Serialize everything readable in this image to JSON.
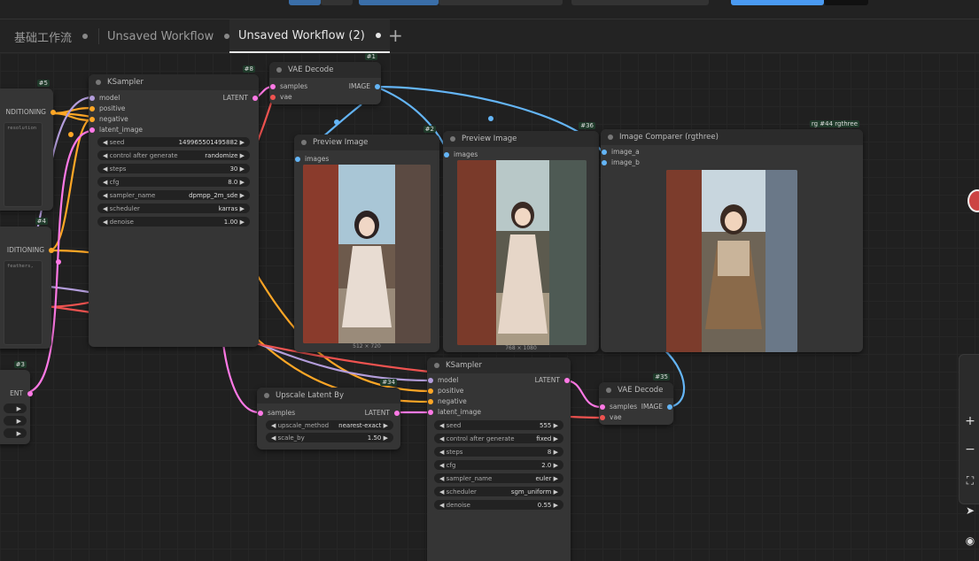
{
  "tabs": [
    {
      "label": "基础工作流",
      "active": false
    },
    {
      "label": "Unsaved Workflow",
      "active": false
    },
    {
      "label": "Unsaved Workflow (2)",
      "active": true
    }
  ],
  "tab_add_icon": "+",
  "colors": {
    "model": "#b39ddb",
    "clip_cond": "#ffa726",
    "latent": "#ff79e6",
    "image": "#64b5f6",
    "vae": "#ef5350"
  },
  "node5": {
    "id": "#5",
    "out_label": "NDITIONING",
    "text": "resolution"
  },
  "node4": {
    "id": "#4",
    "out_label": "IDITIONING",
    "text": "feathers,"
  },
  "node3": {
    "id": "#3",
    "out_label": "ENT"
  },
  "ksampler1": {
    "id": "#8",
    "title": "KSampler",
    "inputs": [
      "model",
      "positive",
      "negative",
      "latent_image"
    ],
    "output": "LATENT",
    "widgets": [
      {
        "name": "seed",
        "value": "149965501495882"
      },
      {
        "name": "control after generate",
        "value": "randomize"
      },
      {
        "name": "steps",
        "value": "30"
      },
      {
        "name": "cfg",
        "value": "8.0"
      },
      {
        "name": "sampler_name",
        "value": "dpmpp_2m_sde"
      },
      {
        "name": "scheduler",
        "value": "karras"
      },
      {
        "name": "denoise",
        "value": "1.00"
      }
    ]
  },
  "vaedecode1": {
    "id": "#1",
    "title": "VAE Decode",
    "inputs": [
      "samples",
      "vae"
    ],
    "output": "IMAGE"
  },
  "preview1": {
    "id": "#2",
    "title": "Preview Image",
    "input": "images",
    "caption": "512 × 720"
  },
  "preview2": {
    "id": "#36",
    "title": "Preview Image",
    "input": "images",
    "caption": "768 × 1080"
  },
  "comparer": {
    "id": "rg #44 rgthree",
    "title": "Image Comparer (rgthree)",
    "inputs": [
      "image_a",
      "image_b"
    ]
  },
  "upscale": {
    "id": "#34",
    "title": "Upscale Latent By",
    "input": "samples",
    "output": "LATENT",
    "widgets": [
      {
        "name": "upscale_method",
        "value": "nearest-exact"
      },
      {
        "name": "scale_by",
        "value": "1.50"
      }
    ]
  },
  "ksampler2": {
    "title": "KSampler",
    "inputs": [
      "model",
      "positive",
      "negative",
      "latent_image"
    ],
    "output": "LATENT",
    "widgets": [
      {
        "name": "seed",
        "value": "555"
      },
      {
        "name": "control after generate",
        "value": "fixed"
      },
      {
        "name": "steps",
        "value": "8"
      },
      {
        "name": "cfg",
        "value": "2.0"
      },
      {
        "name": "sampler_name",
        "value": "euler"
      },
      {
        "name": "scheduler",
        "value": "sgm_uniform"
      },
      {
        "name": "denoise",
        "value": "0.55"
      }
    ]
  },
  "vaedecode2": {
    "id": "#35",
    "title": "VAE Decode",
    "inputs": [
      "samples",
      "vae"
    ],
    "output": "IMAGE"
  },
  "toolbar_icons": [
    "plus-icon",
    "minus-icon",
    "fit-view-icon",
    "select-arrow-icon",
    "eye-icon"
  ]
}
